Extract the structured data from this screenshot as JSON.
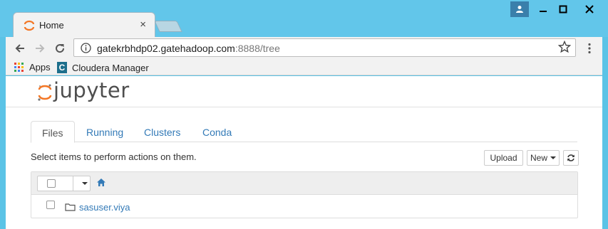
{
  "browser": {
    "tab_title": "Home",
    "tab_close": "×",
    "url_host": "gatekrbhdp02.gatehadoop.com",
    "url_rest": ":8888/tree",
    "bookmarks": [
      {
        "label": "Apps",
        "icon": "apps-grid-icon"
      },
      {
        "label": "Cloudera Manager",
        "icon": "cloudera-icon",
        "icon_text": "C"
      }
    ],
    "colors": {
      "titlebar": "#62c6ea",
      "toolbar": "#f2f2f2"
    }
  },
  "jupyter": {
    "logo_text": "jupyter",
    "tabs": [
      {
        "label": "Files",
        "active": true
      },
      {
        "label": "Running",
        "active": false
      },
      {
        "label": "Clusters",
        "active": false
      },
      {
        "label": "Conda",
        "active": false
      }
    ],
    "select_message": "Select items to perform actions on them.",
    "buttons": {
      "upload": "Upload",
      "new": "New"
    },
    "files": [
      {
        "name": "sasuser.viya",
        "type": "folder"
      }
    ],
    "colors": {
      "accent": "#f37726",
      "link": "#337ab7"
    }
  }
}
